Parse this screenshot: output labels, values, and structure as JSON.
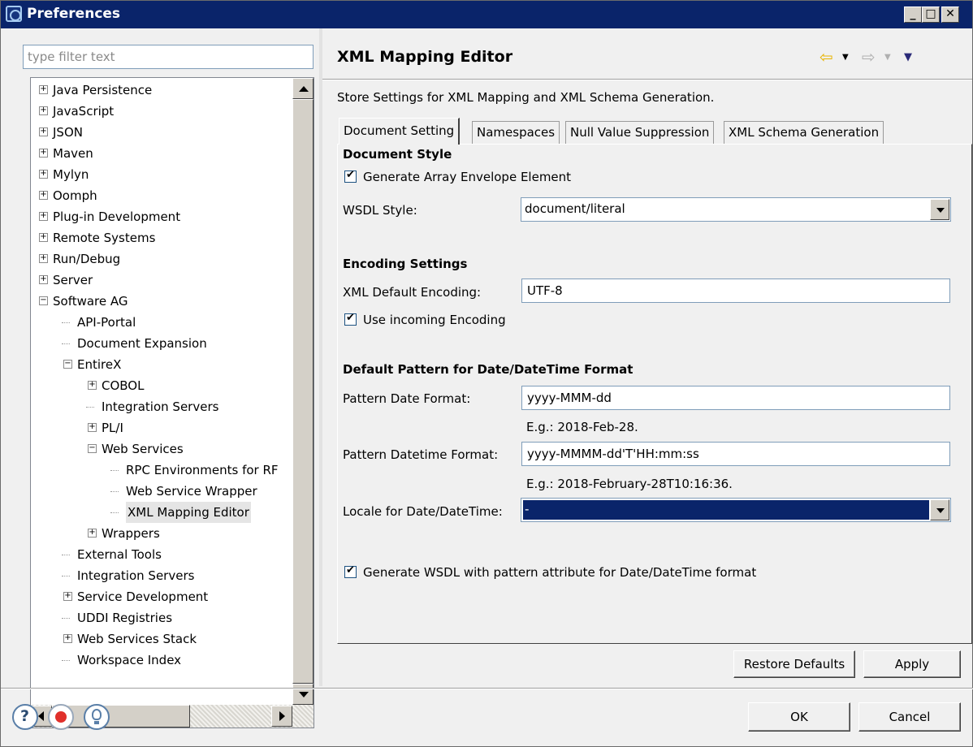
{
  "window": {
    "title": "Preferences"
  },
  "filter": {
    "placeholder": "type filter text"
  },
  "tree": [
    {
      "label": "Java Persistence",
      "depth": 0,
      "toggle": "+"
    },
    {
      "label": "JavaScript",
      "depth": 0,
      "toggle": "+"
    },
    {
      "label": "JSON",
      "depth": 0,
      "toggle": "+"
    },
    {
      "label": "Maven",
      "depth": 0,
      "toggle": "+"
    },
    {
      "label": "Mylyn",
      "depth": 0,
      "toggle": "+"
    },
    {
      "label": "Oomph",
      "depth": 0,
      "toggle": "+"
    },
    {
      "label": "Plug-in Development",
      "depth": 0,
      "toggle": "+"
    },
    {
      "label": "Remote Systems",
      "depth": 0,
      "toggle": "+"
    },
    {
      "label": "Run/Debug",
      "depth": 0,
      "toggle": "+"
    },
    {
      "label": "Server",
      "depth": 0,
      "toggle": "+"
    },
    {
      "label": "Software AG",
      "depth": 0,
      "toggle": "-"
    },
    {
      "label": "API-Portal",
      "depth": 1,
      "toggle": ""
    },
    {
      "label": "Document Expansion",
      "depth": 1,
      "toggle": ""
    },
    {
      "label": "EntireX",
      "depth": 1,
      "toggle": "-"
    },
    {
      "label": "COBOL",
      "depth": 2,
      "toggle": "+"
    },
    {
      "label": "Integration Servers",
      "depth": 2,
      "toggle": ""
    },
    {
      "label": "PL/I",
      "depth": 2,
      "toggle": "+"
    },
    {
      "label": "Web Services",
      "depth": 2,
      "toggle": "-"
    },
    {
      "label": "RPC Environments for RF",
      "depth": 3,
      "toggle": ""
    },
    {
      "label": "Web Service Wrapper",
      "depth": 3,
      "toggle": ""
    },
    {
      "label": "XML Mapping Editor",
      "depth": 3,
      "toggle": "",
      "selected": true
    },
    {
      "label": "Wrappers",
      "depth": 2,
      "toggle": "+"
    },
    {
      "label": "External Tools",
      "depth": 1,
      "toggle": ""
    },
    {
      "label": "Integration Servers",
      "depth": 1,
      "toggle": ""
    },
    {
      "label": "Service Development",
      "depth": 1,
      "toggle": "+"
    },
    {
      "label": "UDDI Registries",
      "depth": 1,
      "toggle": ""
    },
    {
      "label": "Web Services Stack",
      "depth": 1,
      "toggle": "+"
    },
    {
      "label": "Workspace Index",
      "depth": 1,
      "toggle": ""
    }
  ],
  "page": {
    "title": "XML Mapping Editor",
    "description": "Store Settings for XML Mapping and XML Schema Generation.",
    "tabs": [
      "Document Setting",
      "Namespaces",
      "Null Value Suppression",
      "XML Schema Generation"
    ],
    "active_tab": "Document Setting"
  },
  "document_style": {
    "heading": "Document Style",
    "generate_envelope_label": "Generate Array Envelope Element",
    "generate_envelope_checked": true,
    "wsdl_style_label": "WSDL Style:",
    "wsdl_style_value": "document/literal"
  },
  "encoding": {
    "heading": "Encoding Settings",
    "default_encoding_label": "XML Default Encoding:",
    "default_encoding_value": "UTF-8",
    "use_incoming_label": "Use incoming Encoding",
    "use_incoming_checked": true
  },
  "date_format": {
    "heading": "Default Pattern for Date/DateTime Format",
    "date_label": "Pattern Date Format:",
    "date_value": "yyyy-MMM-dd",
    "date_example": "E.g.: 2018-Feb-28.",
    "datetime_label": "Pattern Datetime Format:",
    "datetime_value": "yyyy-MMMM-dd'T'HH:mm:ss",
    "datetime_example": "E.g.: 2018-February-28T10:16:36.",
    "locale_label": "Locale for Date/DateTime:",
    "locale_value": "-",
    "wsdl_pattern_label": "Generate WSDL with pattern attribute for Date/DateTime format",
    "wsdl_pattern_checked": true
  },
  "buttons": {
    "restore_defaults": "Restore Defaults",
    "apply": "Apply",
    "ok": "OK",
    "cancel": "Cancel"
  },
  "colors": {
    "titlebar": "#0a246a",
    "selection": "#0a246a",
    "nav_back": "#f0c020",
    "stop_icon": "#e0302b",
    "tip_icon": "#5a7fa8"
  }
}
